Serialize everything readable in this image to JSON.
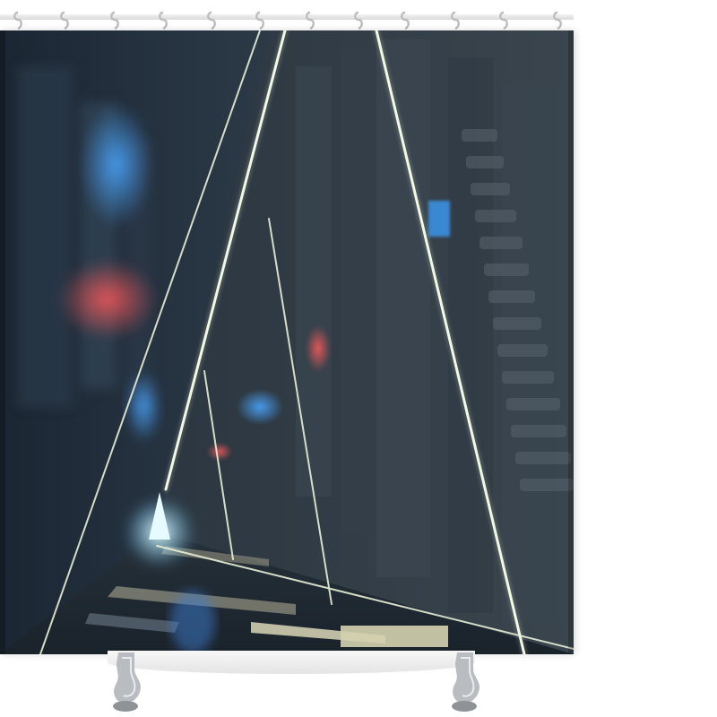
{
  "scene": {
    "subject": "",
    "colors": {
      "wall_dark": "#1e2a36",
      "wall_mid": "#2f3c47",
      "neon_line": "#e9f1d8",
      "accent_blue": "#3b8fe0",
      "accent_red": "#d94a4a",
      "end_glow": "#d7f7ff",
      "floor_light": "#d9d6b6"
    }
  },
  "hardware": {
    "hook_count": 12,
    "rod_color": "#e6e6e6",
    "hook_color": "#c9c9c9"
  }
}
